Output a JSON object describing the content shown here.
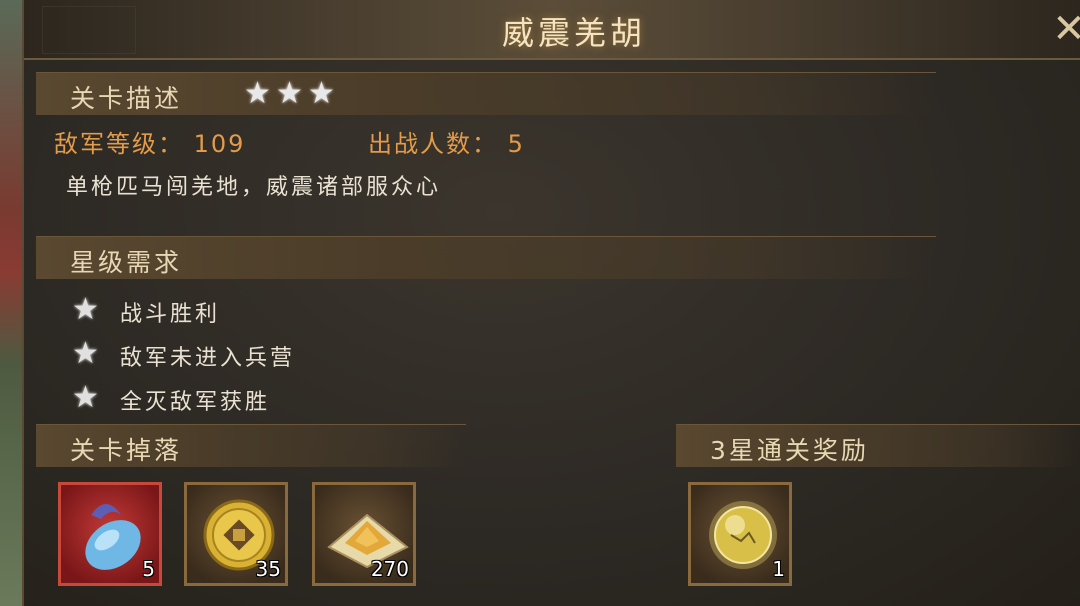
{
  "title": "威震羌胡",
  "close_label": "✕",
  "description": {
    "header": "关卡描述",
    "stars": 3,
    "enemy_level_label": "敌军等级：",
    "enemy_level_value": "109",
    "troop_count_label": "出战人数：",
    "troop_count_value": "5",
    "text": "单枪匹马闯羌地，威震诸部服众心"
  },
  "star_requirements": {
    "header": "星级需求",
    "items": [
      {
        "label": "战斗胜利"
      },
      {
        "label": "敌军未进入兵营"
      },
      {
        "label": "全灭敌军获胜"
      }
    ]
  },
  "drops": {
    "header": "关卡掉落",
    "items": [
      {
        "icon": "blue-gem-icon",
        "count": "5"
      },
      {
        "icon": "gold-coin-icon",
        "count": "35"
      },
      {
        "icon": "sand-pile-icon",
        "count": "270"
      }
    ]
  },
  "reward": {
    "header": "3星通关奖励",
    "items": [
      {
        "icon": "golden-orb-icon",
        "count": "1"
      }
    ]
  },
  "colors": {
    "accent_orange": "#e39b4a",
    "text_light": "#e9e2d2",
    "title": "#f3e4c3"
  }
}
